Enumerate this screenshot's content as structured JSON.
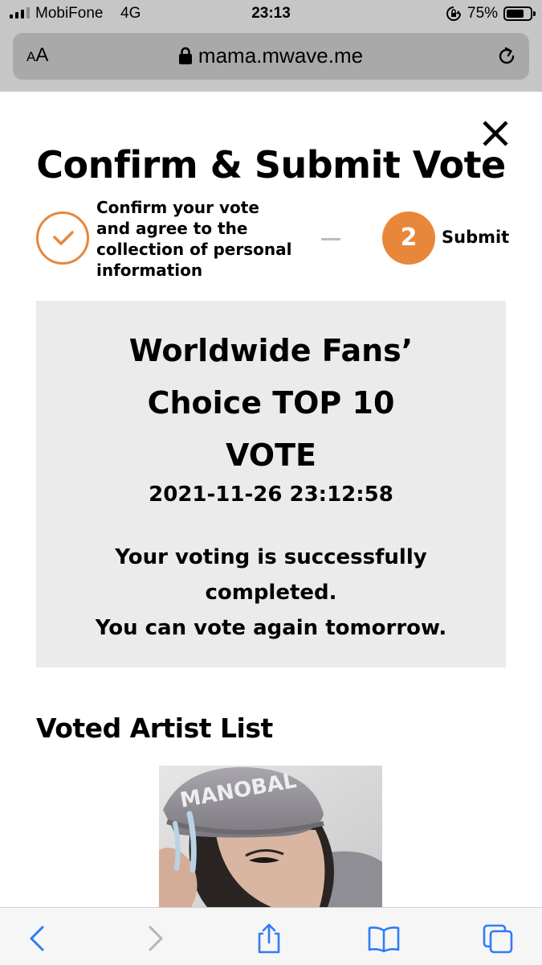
{
  "status_bar": {
    "carrier": "MobiFone",
    "network": "4G",
    "time": "23:13",
    "battery_percent": "75%",
    "battery_level": 0.75
  },
  "browser": {
    "text_size_button_small": "A",
    "text_size_button_large": "A",
    "url": "mama.mwave.me"
  },
  "modal": {
    "title": "Confirm & Submit Vote",
    "steps": [
      {
        "label_lines": [
          "Confirm your vote",
          "and agree to the",
          "collection of personal",
          "information"
        ],
        "state": "done"
      },
      {
        "number": "2",
        "label": "Submit",
        "state": "active"
      }
    ],
    "result": {
      "vote_title_lines": [
        "Worldwide Fans’",
        "Choice TOP 10",
        "VOTE"
      ],
      "timestamp": "2021-11-26 23:12:58",
      "message_lines": [
        "Your voting is successfully",
        "completed.",
        "You can vote again tomorrow."
      ]
    },
    "voted_artist_heading": "Voted Artist List",
    "artist_photo_cap_text": "MANOBAL"
  },
  "colors": {
    "accent": "#e8873a",
    "result_box_bg": "#ebebeb",
    "browser_chrome": "#c6c6c6",
    "ios_blue": "#2f7cf6"
  },
  "toolbar": {
    "icons": [
      "back-icon",
      "forward-icon",
      "share-icon",
      "bookmarks-icon",
      "tabs-icon"
    ]
  }
}
